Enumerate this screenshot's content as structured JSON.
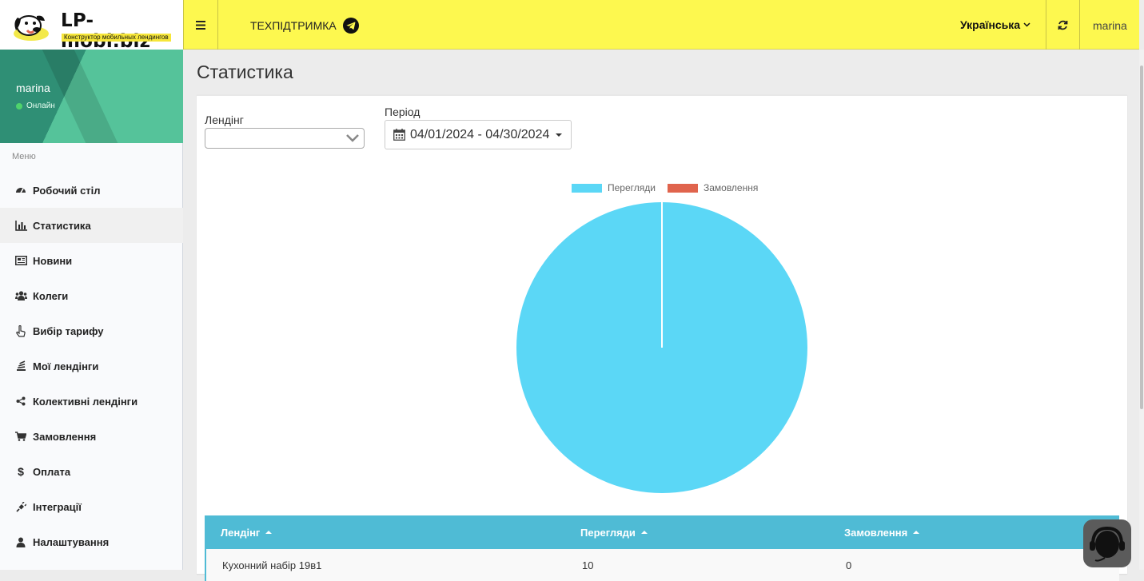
{
  "brand": {
    "title": "LP-mobi.biz",
    "subtitle": "Конструктор мобильных лендингов"
  },
  "user": {
    "name": "marina",
    "status": "Онлайн",
    "status_color": "#4fd36c"
  },
  "sidebar": {
    "menu_header": "Меню",
    "items": [
      {
        "label": "Робочий стіл",
        "icon": "dashboard-icon"
      },
      {
        "label": "Статистика",
        "icon": "bar-chart-icon",
        "active": true
      },
      {
        "label": "Новини",
        "icon": "newspaper-icon"
      },
      {
        "label": "Колеги",
        "icon": "users-icon"
      },
      {
        "label": "Вибір тарифу",
        "icon": "hand-pointer-icon"
      },
      {
        "label": "Мої лендінги",
        "icon": "stack-icon"
      },
      {
        "label": "Колективні лендінги",
        "icon": "share-icon"
      },
      {
        "label": "Замовлення",
        "icon": "cart-icon"
      },
      {
        "label": "Оплата",
        "icon": "dollar-icon"
      },
      {
        "label": "Інтеграції",
        "icon": "plug-icon"
      },
      {
        "label": "Налаштування",
        "icon": "user-icon"
      }
    ]
  },
  "topbar": {
    "support_label": "ТЕХПІДТРИМКА",
    "language": "Українська",
    "user": "marina",
    "bg_color": "#fdf84f"
  },
  "page": {
    "title": "Статистика"
  },
  "filters": {
    "landing_label": "Лендінг",
    "landing_value": "",
    "period_label": "Період",
    "period_value": "04/01/2024 - 04/30/2024"
  },
  "chart_data": {
    "type": "pie",
    "labels": [
      "Перегляди",
      "Замовлення"
    ],
    "values": [
      10,
      0
    ],
    "colors": [
      "#5bd7f6",
      "#e0644d"
    ],
    "legend": "top",
    "title": ""
  },
  "table": {
    "headers": [
      "Лендінг",
      "Перегляди",
      "Замовлення"
    ],
    "header_color": "#4fbbd5",
    "rows": [
      [
        "Кухонний набір 19в1",
        "10",
        "0"
      ]
    ]
  }
}
